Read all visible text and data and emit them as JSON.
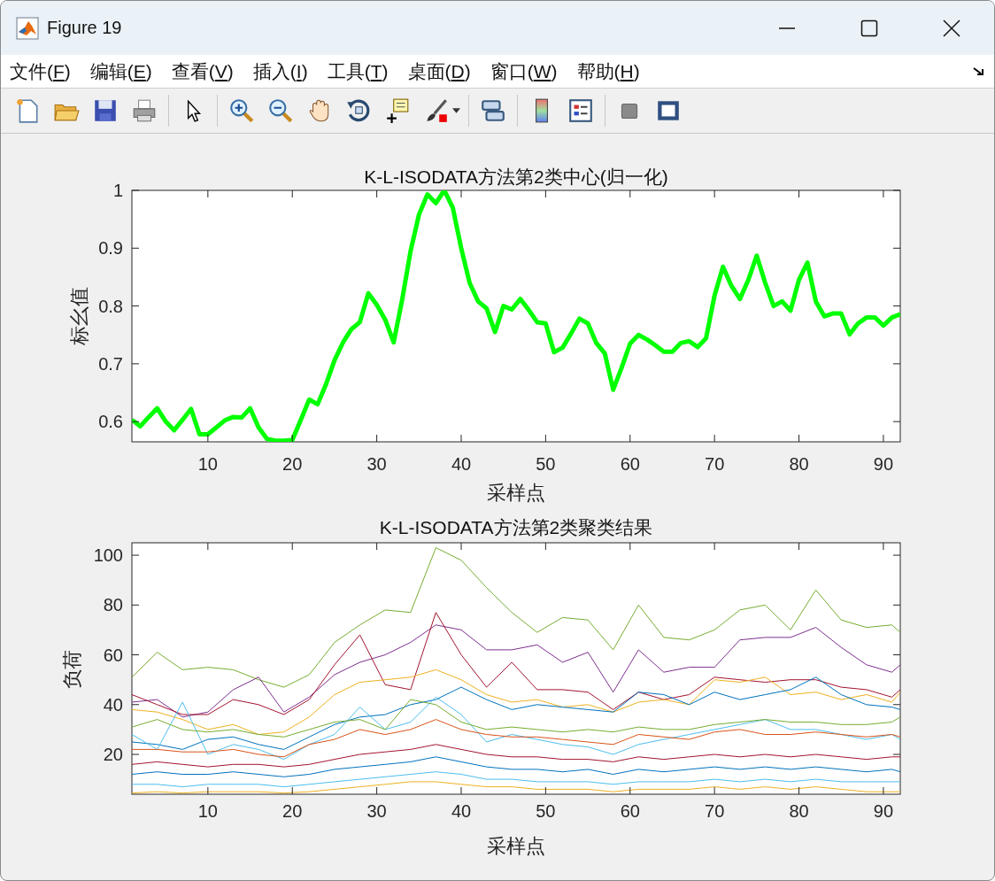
{
  "window": {
    "title": "Figure 19"
  },
  "menu": [
    {
      "label": "文件(F)"
    },
    {
      "label": "编辑(E)"
    },
    {
      "label": "查看(V)"
    },
    {
      "label": "插入(I)"
    },
    {
      "label": "工具(T)"
    },
    {
      "label": "桌面(D)"
    },
    {
      "label": "窗口(W)"
    },
    {
      "label": "帮助(H)"
    }
  ],
  "axes": [
    {
      "chart_data": {
        "type": "line",
        "title": "K-L-ISODATA方法第2类中心(归一化)",
        "xlabel": "采样点",
        "ylabel": "标幺值",
        "xlim": [
          1,
          92
        ],
        "ylim": [
          0.565,
          1
        ],
        "xticks": [
          10,
          20,
          30,
          40,
          50,
          60,
          70,
          80,
          90
        ],
        "yticks": [
          0.6,
          0.7,
          0.8,
          0.9,
          1
        ],
        "x": [
          1,
          2,
          3,
          4,
          5,
          6,
          7,
          8,
          9,
          10,
          11,
          12,
          13,
          14,
          15,
          16,
          17,
          18,
          19,
          20,
          21,
          22,
          23,
          24,
          25,
          26,
          27,
          28,
          29,
          30,
          31,
          32,
          33,
          34,
          35,
          36,
          37,
          38,
          39,
          40,
          41,
          42,
          43,
          44,
          45,
          46,
          47,
          48,
          49,
          50,
          51,
          52,
          53,
          54,
          55,
          56,
          57,
          58,
          59,
          60,
          61,
          62,
          63,
          64,
          65,
          66,
          67,
          68,
          69,
          70,
          71,
          72,
          73,
          74,
          75,
          76,
          77,
          78,
          79,
          80,
          81,
          82,
          83,
          84,
          85,
          86,
          87,
          88,
          89,
          90,
          91,
          92
        ],
        "series": [
          {
            "color": "#00ff00",
            "values": [
              0.603,
              0.592,
              0.608,
              0.623,
              0.6,
              0.585,
              0.603,
              0.622,
              0.578,
              0.578,
              0.59,
              0.602,
              0.608,
              0.607,
              0.623,
              0.59,
              0.57,
              0.567,
              0.567,
              0.568,
              0.603,
              0.638,
              0.63,
              0.665,
              0.706,
              0.737,
              0.76,
              0.772,
              0.822,
              0.802,
              0.776,
              0.737,
              0.81,
              0.895,
              0.958,
              0.993,
              0.978,
              1.0,
              0.97,
              0.9,
              0.84,
              0.808,
              0.796,
              0.755,
              0.8,
              0.794,
              0.812,
              0.793,
              0.772,
              0.77,
              0.72,
              0.728,
              0.752,
              0.778,
              0.77,
              0.736,
              0.718,
              0.655,
              0.693,
              0.735,
              0.75,
              0.742,
              0.732,
              0.721,
              0.721,
              0.736,
              0.739,
              0.729,
              0.744,
              0.818,
              0.868,
              0.835,
              0.812,
              0.845,
              0.887,
              0.84,
              0.8,
              0.808,
              0.792,
              0.845,
              0.875,
              0.808,
              0.782,
              0.787,
              0.787,
              0.751,
              0.77,
              0.78,
              0.78,
              0.766,
              0.78,
              0.786
            ]
          }
        ]
      }
    },
    {
      "chart_data": {
        "type": "line",
        "title": "K-L-ISODATA方法第2类聚类结果",
        "xlabel": "采样点",
        "ylabel": "负荷",
        "xlim": [
          1,
          92
        ],
        "ylim": [
          4,
          105
        ],
        "xticks": [
          10,
          20,
          30,
          40,
          50,
          60,
          70,
          80,
          90
        ],
        "yticks": [
          20,
          40,
          60,
          80,
          100
        ],
        "x": [
          1,
          4,
          7,
          10,
          13,
          16,
          19,
          22,
          25,
          28,
          31,
          34,
          37,
          40,
          43,
          46,
          49,
          52,
          55,
          58,
          61,
          64,
          67,
          70,
          73,
          76,
          79,
          82,
          85,
          88,
          91,
          92
        ],
        "series": [
          {
            "color": "#77ac30",
            "values": [
              51,
              61,
              54,
              55,
              54,
              50,
              47,
              52,
              65,
              72,
              78,
              77,
              103,
              98,
              87,
              77,
              69,
              75,
              74,
              62,
              80,
              67,
              66,
              70,
              78,
              80,
              70,
              86,
              74,
              71,
              72,
              69
            ]
          },
          {
            "color": "#7e2f8e",
            "values": [
              41,
              42,
              35,
              37,
              46,
              51,
              37,
              43,
              52,
              57,
              60,
              65,
              72,
              70,
              62,
              62,
              64,
              57,
              61,
              45,
              62,
              53,
              55,
              55,
              66,
              67,
              67,
              71,
              63,
              56,
              53,
              56
            ]
          },
          {
            "color": "#a2142f",
            "values": [
              44,
              40,
              36,
              36,
              42,
              40,
              36,
              42,
              56,
              68,
              48,
              46,
              77,
              60,
              47,
              57,
              46,
              46,
              45,
              38,
              45,
              42,
              44,
              51,
              50,
              49,
              50,
              50,
              47,
              46,
              43,
              46
            ]
          },
          {
            "color": "#edb120",
            "values": [
              38,
              37,
              34,
              30,
              32,
              28,
              29,
              35,
              44,
              49,
              50,
              51,
              54,
              50,
              44,
              41,
              42,
              39,
              40,
              37,
              41,
              42,
              40,
              50,
              49,
              51,
              44,
              45,
              42,
              44,
              41,
              45
            ]
          },
          {
            "color": "#0072bd",
            "values": [
              25,
              24,
              22,
              26,
              27,
              24,
              22,
              27,
              32,
              35,
              36,
              40,
              42,
              47,
              42,
              38,
              40,
              39,
              38,
              37,
              45,
              44,
              40,
              45,
              42,
              44,
              46,
              51,
              44,
              40,
              39,
              38
            ]
          },
          {
            "color": "#4dbeee",
            "values": [
              28,
              22,
              41,
              20,
              24,
              22,
              18,
              24,
              28,
              39,
              30,
              33,
              43,
              36,
              25,
              28,
              26,
              24,
              23,
              20,
              24,
              26,
              28,
              30,
              32,
              34,
              30,
              30,
              28,
              26,
              28,
              26
            ]
          },
          {
            "color": "#77ac30",
            "values": [
              31,
              34,
              30,
              29,
              30,
              28,
              27,
              30,
              33,
              34,
              30,
              42,
              40,
              33,
              30,
              31,
              30,
              29,
              30,
              29,
              31,
              30,
              30,
              32,
              33,
              34,
              33,
              33,
              32,
              32,
              33,
              35
            ]
          },
          {
            "color": "#d95319",
            "values": [
              22,
              22,
              21,
              21,
              22,
              20,
              19,
              24,
              26,
              30,
              28,
              30,
              34,
              30,
              28,
              27,
              27,
              26,
              25,
              24,
              28,
              27,
              26,
              29,
              30,
              28,
              28,
              29,
              28,
              27,
              28,
              27
            ]
          },
          {
            "color": "#a2142f",
            "values": [
              16,
              17,
              16,
              15,
              16,
              16,
              15,
              16,
              18,
              20,
              21,
              22,
              24,
              22,
              20,
              19,
              19,
              18,
              18,
              17,
              19,
              18,
              19,
              20,
              19,
              20,
              19,
              20,
              19,
              18,
              19,
              19
            ]
          },
          {
            "color": "#0072bd",
            "values": [
              12,
              13,
              12,
              12,
              13,
              12,
              11,
              12,
              14,
              15,
              16,
              17,
              19,
              17,
              15,
              14,
              14,
              13,
              14,
              12,
              14,
              13,
              14,
              15,
              14,
              15,
              14,
              15,
              14,
              13,
              14,
              13
            ]
          },
          {
            "color": "#4dbeee",
            "values": [
              8,
              8,
              7,
              8,
              8,
              8,
              7,
              8,
              9,
              10,
              11,
              12,
              13,
              12,
              10,
              10,
              9,
              9,
              9,
              8,
              9,
              9,
              9,
              10,
              9,
              10,
              9,
              10,
              9,
              9,
              9,
              9
            ]
          },
          {
            "color": "#edb120",
            "values": [
              4.5,
              5,
              4.5,
              5,
              5,
              5,
              4.5,
              5,
              6,
              7,
              8,
              9,
              9,
              8,
              7,
              7,
              6,
              6,
              6,
              5,
              6,
              6,
              6,
              7,
              6,
              7,
              6,
              7,
              6,
              5,
              5,
              5
            ]
          }
        ]
      }
    }
  ]
}
